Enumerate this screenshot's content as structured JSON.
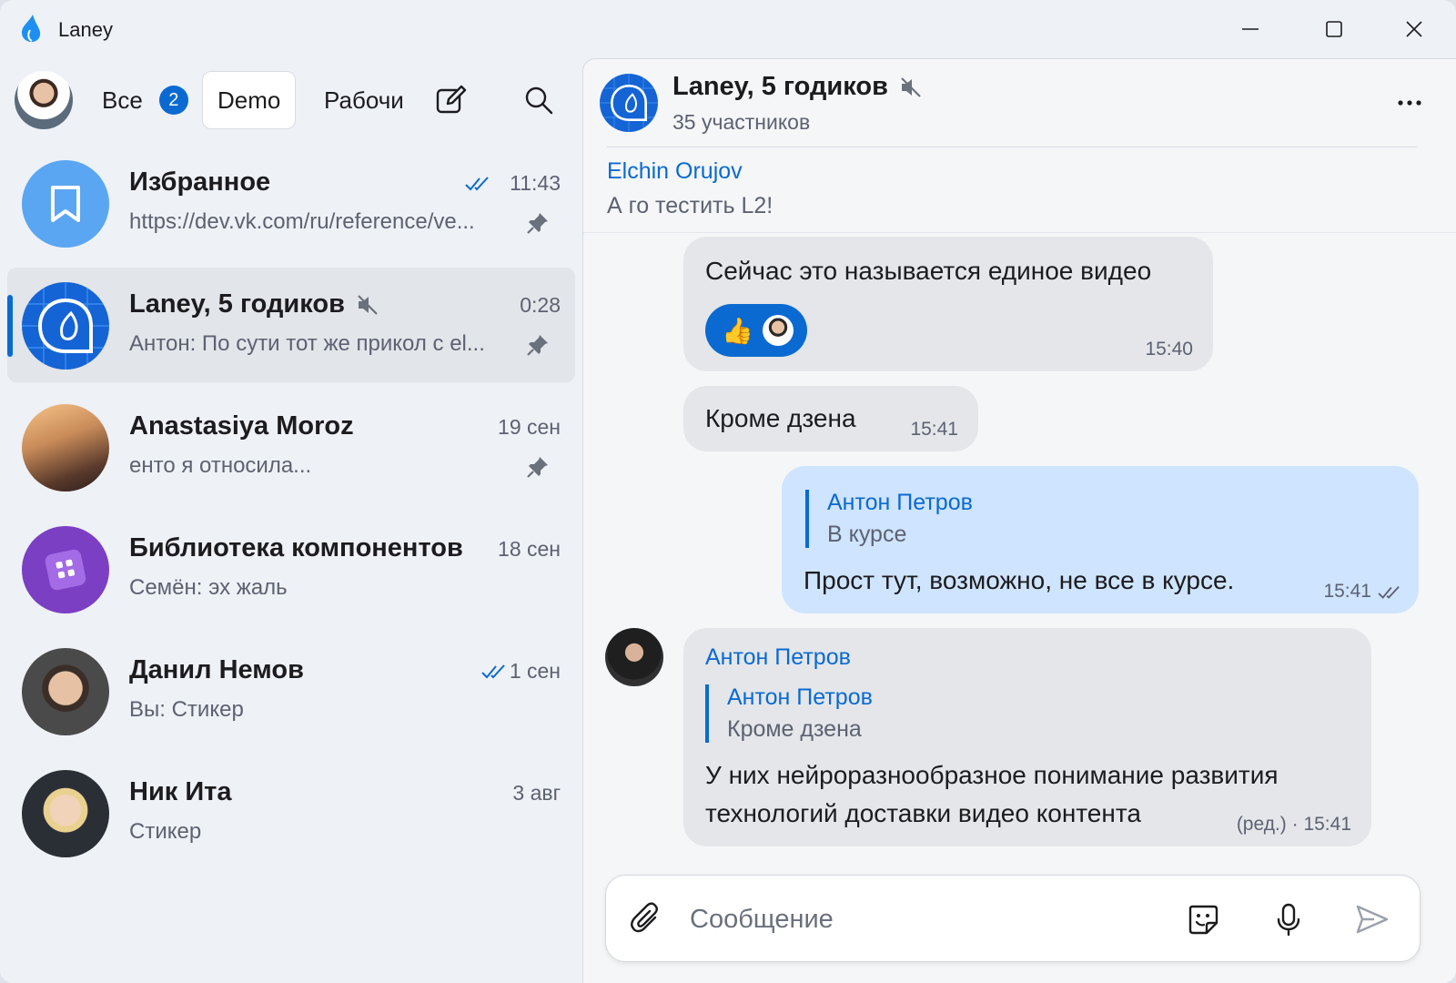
{
  "window": {
    "title": "Laney"
  },
  "folders": [
    {
      "label": "Все",
      "badge": "2"
    },
    {
      "label": "Demo"
    },
    {
      "label": "Рабочи"
    }
  ],
  "chats": [
    {
      "name": "Избранное",
      "time": "11:43",
      "preview": "https://dev.vk.com/ru/reference/ve...",
      "pinned": true,
      "read": true
    },
    {
      "name": "Laney, 5 годиков",
      "time": "0:28",
      "preview": "Антон: По сути тот же прикол с el...",
      "pinned": true,
      "muted": true,
      "active": true
    },
    {
      "name": "Anastasiya Moroz",
      "time": "19 сен",
      "preview": "енто я относила...",
      "pinned": true
    },
    {
      "name": "Библиотека компонентов",
      "time": "18 сен",
      "preview": "Семён: эх жаль"
    },
    {
      "name": "Данил Немов",
      "time": "1 сен",
      "preview": "Вы: Стикер",
      "read": true
    },
    {
      "name": "Ник Ита",
      "time": "3 авг",
      "preview": "Стикер"
    }
  ],
  "conversation": {
    "title": "Laney, 5 годиков",
    "subtitle": "35 участников",
    "pinned": {
      "name": "Elchin Orujov",
      "text": "А го тестить L2!"
    },
    "messages": [
      {
        "text": "Сейчас это называется единое видео",
        "time": "15:40",
        "reaction": "👍"
      },
      {
        "text": "Кроме дзена",
        "time": "15:41"
      },
      {
        "reply_name": "Антон Петров",
        "reply_text": "В курсе",
        "text": "Прост тут, возможно, не все в курсе.",
        "time": "15:41"
      },
      {
        "sender": "Антон Петров",
        "reply_name": "Антон Петров",
        "reply_text": "Кроме дзена",
        "text_line1": "У них нейроразнообразное понимание развития",
        "text_line2": "технологий доставки видео контента",
        "time": "(ред.) · 15:41"
      }
    ]
  },
  "composer": {
    "placeholder": "Сообщение"
  },
  "colors": {
    "accent": "#0a6ad1",
    "outgoing_bubble": "#cfe4ff",
    "incoming_bubble": "#e4e6ea"
  }
}
